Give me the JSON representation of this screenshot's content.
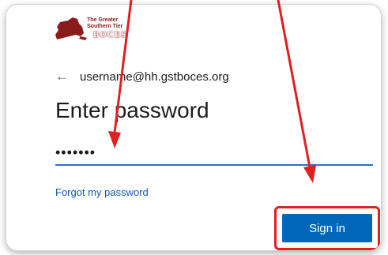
{
  "logo": {
    "line1": "The Greater",
    "line2": "Southern Tier",
    "brand": "BOCES"
  },
  "identity": {
    "back_icon": "back-arrow-icon",
    "email": "username@hh.gstboces.org"
  },
  "title": "Enter password",
  "password": {
    "value": "•••••••"
  },
  "forgot_link": "Forgot my password",
  "sign_in_button": "Sign in",
  "colors": {
    "accent": "#0067b8",
    "annotation": "#e01f1f",
    "input_underline": "#2f6fd1"
  }
}
